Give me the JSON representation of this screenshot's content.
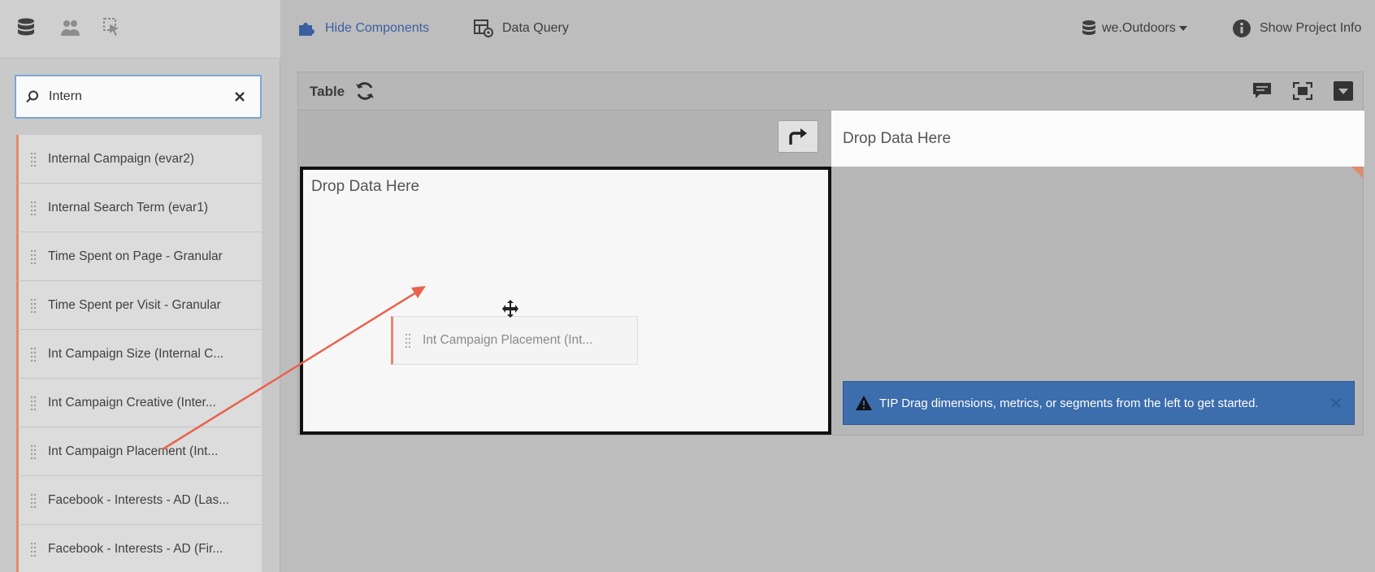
{
  "sidebar": {
    "search": {
      "value": "Intern"
    },
    "items": [
      {
        "label": "Internal Campaign (evar2)"
      },
      {
        "label": "Internal Search Term (evar1)"
      },
      {
        "label": "Time Spent on Page - Granular"
      },
      {
        "label": "Time Spent per Visit - Granular"
      },
      {
        "label": "Int Campaign Size (Internal C..."
      },
      {
        "label": "Int Campaign Creative (Inter..."
      },
      {
        "label": "Int Campaign Placement (Int..."
      },
      {
        "label": "Facebook - Interests - AD (Las..."
      },
      {
        "label": "Facebook - Interests - AD (Fir..."
      }
    ]
  },
  "toolbar": {
    "hide_components": "Hide Components",
    "data_query": "Data Query",
    "report_suite": "we.Outdoors",
    "show_project_info": "Show Project Info"
  },
  "panel": {
    "title": "Table",
    "column_drop": "Drop Data Here",
    "row_drop": "Drop Data Here",
    "drag_item": "Int Campaign Placement (Int...",
    "tip": "TIP Drag dimensions, metrics, or segments from the left to get started."
  },
  "colors": {
    "accent": "#e4896a",
    "tip_bg": "#3c6dac",
    "link_blue": "#3b5fa0",
    "annotation_arrow": "#e8624c"
  }
}
